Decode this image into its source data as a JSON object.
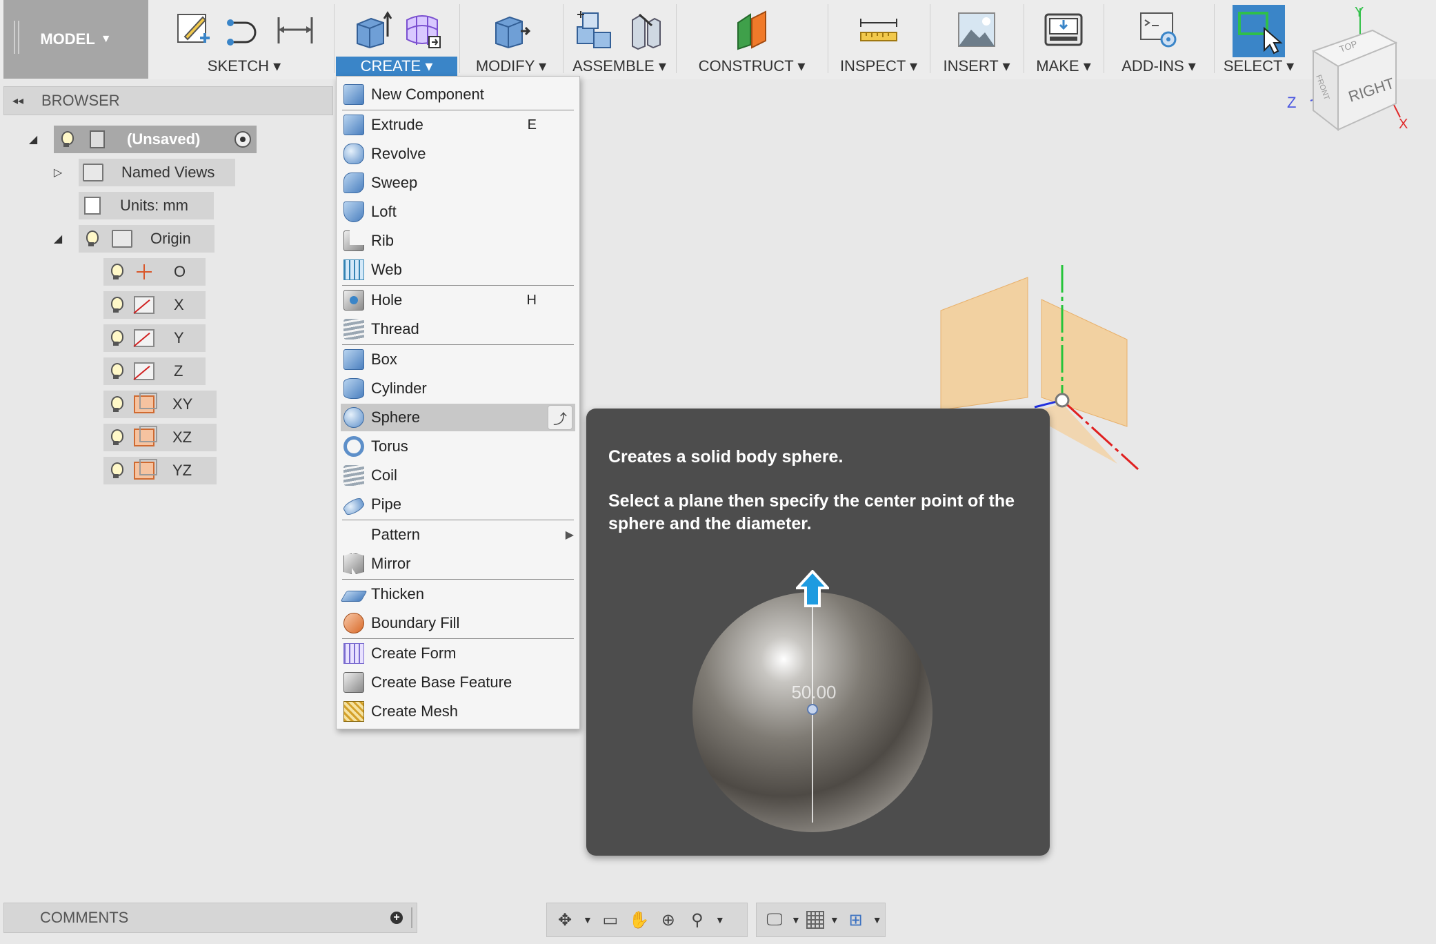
{
  "toolbar": {
    "mode": "MODEL",
    "groups": [
      {
        "label": "SKETCH ▾"
      },
      {
        "label": "CREATE ▾"
      },
      {
        "label": "MODIFY ▾"
      },
      {
        "label": "ASSEMBLE ▾"
      },
      {
        "label": "CONSTRUCT ▾"
      },
      {
        "label": "INSPECT ▾"
      },
      {
        "label": "INSERT ▾"
      },
      {
        "label": "MAKE ▾"
      },
      {
        "label": "ADD-INS ▾"
      },
      {
        "label": "SELECT ▾"
      }
    ]
  },
  "viewcube": {
    "face": "RIGHT",
    "top": "TOP",
    "front": "FRONT",
    "axis_x": "X",
    "axis_y": "Y",
    "axis_z": "Z"
  },
  "browser": {
    "title": "BROWSER",
    "root": "(Unsaved)",
    "items": [
      {
        "label": "Named Views"
      },
      {
        "label": "Units: mm"
      },
      {
        "label": "Origin"
      },
      {
        "label": "O"
      },
      {
        "label": "X"
      },
      {
        "label": "Y"
      },
      {
        "label": "Z"
      },
      {
        "label": "XY"
      },
      {
        "label": "XZ"
      },
      {
        "label": "YZ"
      }
    ]
  },
  "create_menu": {
    "items": [
      {
        "label": "New Component"
      },
      {
        "label": "Extrude",
        "shortcut": "E"
      },
      {
        "label": "Revolve"
      },
      {
        "label": "Sweep"
      },
      {
        "label": "Loft"
      },
      {
        "label": "Rib"
      },
      {
        "label": "Web"
      },
      {
        "label": "Hole",
        "shortcut": "H"
      },
      {
        "label": "Thread"
      },
      {
        "label": "Box"
      },
      {
        "label": "Cylinder"
      },
      {
        "label": "Sphere"
      },
      {
        "label": "Torus"
      },
      {
        "label": "Coil"
      },
      {
        "label": "Pipe"
      },
      {
        "label": "Pattern"
      },
      {
        "label": "Mirror"
      },
      {
        "label": "Thicken"
      },
      {
        "label": "Boundary Fill"
      },
      {
        "label": "Create Form"
      },
      {
        "label": "Create Base Feature"
      },
      {
        "label": "Create Mesh"
      }
    ],
    "highlighted": "Sphere"
  },
  "tooltip": {
    "title": "Creates a solid body sphere.",
    "description": "Select a plane then specify the center point of the sphere and the diameter.",
    "dimension": "50.00"
  },
  "comments": {
    "title": "COMMENTS"
  },
  "colors": {
    "accent": "#3a85c8",
    "menu_highlight": "#c8c8c8",
    "tooltip_bg": "#4d4d4d",
    "plane": "#f6c98a"
  }
}
